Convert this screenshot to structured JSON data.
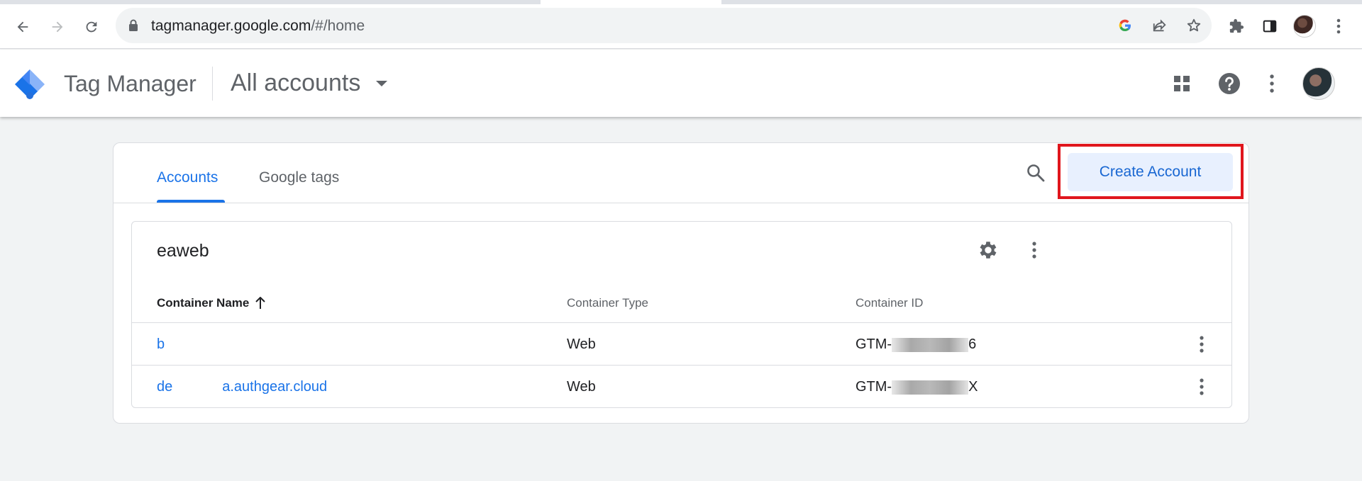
{
  "browser": {
    "url_host": "tagmanager.google.com",
    "url_path": "/#/home"
  },
  "app": {
    "name": "Tag Manager",
    "account_picker": "All accounts"
  },
  "tabs": [
    {
      "label": "Accounts",
      "active": true
    },
    {
      "label": "Google tags",
      "active": false
    }
  ],
  "create_account_label": "Create Account",
  "account": {
    "name": "eaweb",
    "columns": [
      "Container Name",
      "Container Type",
      "Container ID"
    ],
    "rows": [
      {
        "name_prefix": "b",
        "name_suffix": "",
        "type": "Web",
        "id_prefix": "GTM-",
        "id_suffix": "6"
      },
      {
        "name_prefix": "de",
        "name_suffix": "a.authgear.cloud",
        "type": "Web",
        "id_prefix": "GTM-",
        "id_suffix": "X"
      }
    ]
  },
  "colors": {
    "accent": "#1a73e8",
    "highlight": "#e0161d"
  }
}
